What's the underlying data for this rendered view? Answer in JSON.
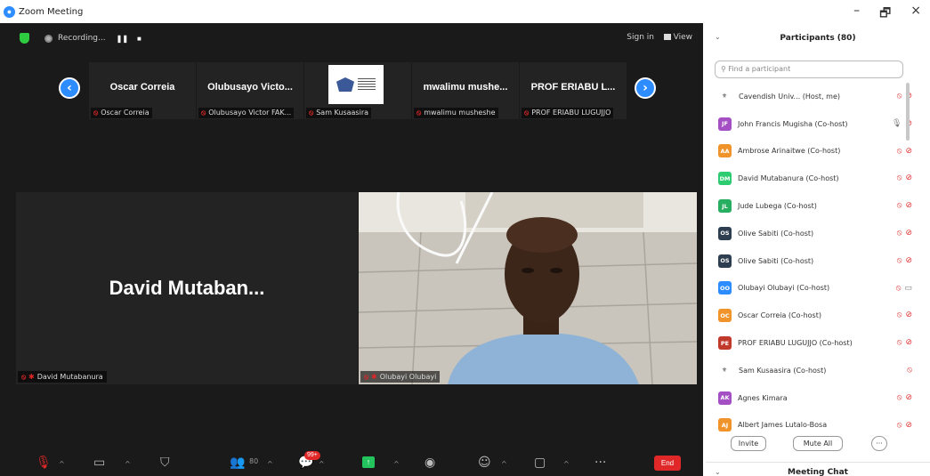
{
  "window": {
    "title": "Zoom Meeting",
    "controls": {
      "minimize": "–",
      "restore": "🗗",
      "close": "×"
    }
  },
  "topbar": {
    "recording_label": "Recording...",
    "pause_label": "❚❚",
    "stop_label": "■",
    "sign_in_label": "Sign in",
    "view_label": "View"
  },
  "thumbnails": [
    {
      "name": "Oscar Correia",
      "label": "Oscar Correia"
    },
    {
      "name": "Olubusayo Victo...",
      "label": "Olubusayo Victor FAK..."
    },
    {
      "name": "",
      "label": "Sam Kusaasira"
    },
    {
      "name": "mwalimu mushe...",
      "label": "mwalimu musheshe"
    },
    {
      "name": "PROF ERIABU L...",
      "label": "PROF ERIABU LUGUJJO"
    }
  ],
  "nav": {
    "prev": "‹",
    "next": "›"
  },
  "main_tiles": {
    "left": {
      "big_name": "David Mutaban...",
      "label": "David Mutabanura"
    },
    "right": {
      "label": "Olubayi Olubayi"
    }
  },
  "toolbar": {
    "participants_count": "80",
    "chat_badge": "99+",
    "end_label": "End"
  },
  "participants": {
    "title": "Participants (80)",
    "search_placeholder": "Find a participant",
    "items": [
      {
        "initials": "",
        "name": "Cavendish Univ... (Host, me)",
        "color": "#ffffff",
        "mic": "muted",
        "video": "off",
        "has_img": true
      },
      {
        "initials": "JF",
        "name": "John Francis Mugisha (Co-host)",
        "color": "#a54fc5",
        "mic": "on",
        "video": "off"
      },
      {
        "initials": "AA",
        "name": "Ambrose Arinaitwe (Co-host)",
        "color": "#f0932b",
        "mic": "muted",
        "video": "off"
      },
      {
        "initials": "DM",
        "name": "David Mutabanura (Co-host)",
        "color": "#2ecc71",
        "mic": "muted",
        "video": "off"
      },
      {
        "initials": "JL",
        "name": "Jude Lubega (Co-host)",
        "color": "#27ae60",
        "mic": "muted",
        "video": "off"
      },
      {
        "initials": "OS",
        "name": "Olive Sabiti (Co-host)",
        "color": "#2c3e50",
        "mic": "muted",
        "video": "off"
      },
      {
        "initials": "OS",
        "name": "Olive Sabiti (Co-host)",
        "color": "#2c3e50",
        "mic": "muted",
        "video": "off"
      },
      {
        "initials": "OO",
        "name": "Olubayi Olubayi (Co-host)",
        "color": "#2d8cff",
        "mic": "muted",
        "video": "on"
      },
      {
        "initials": "OC",
        "name": "Oscar Correia (Co-host)",
        "color": "#f0932b",
        "mic": "muted",
        "video": "off"
      },
      {
        "initials": "PE",
        "name": "PROF ERIABU LUGUJJO (Co-host)",
        "color": "#c0392b",
        "mic": "muted",
        "video": "off"
      },
      {
        "initials": "",
        "name": "Sam Kusaasira (Co-host)",
        "color": "#ffffff",
        "mic": "muted",
        "video": "none",
        "has_img": true
      },
      {
        "initials": "AK",
        "name": "Agnes Kimara",
        "color": "#a54fc5",
        "mic": "muted",
        "video": "off"
      },
      {
        "initials": "AJ",
        "name": "Albert James Lutalo-Bosa",
        "color": "#f0932b",
        "mic": "muted",
        "video": "off"
      }
    ],
    "invite_label": "Invite",
    "mute_all_label": "Mute All",
    "more_label": "···"
  },
  "chat": {
    "title": "Meeting Chat"
  }
}
